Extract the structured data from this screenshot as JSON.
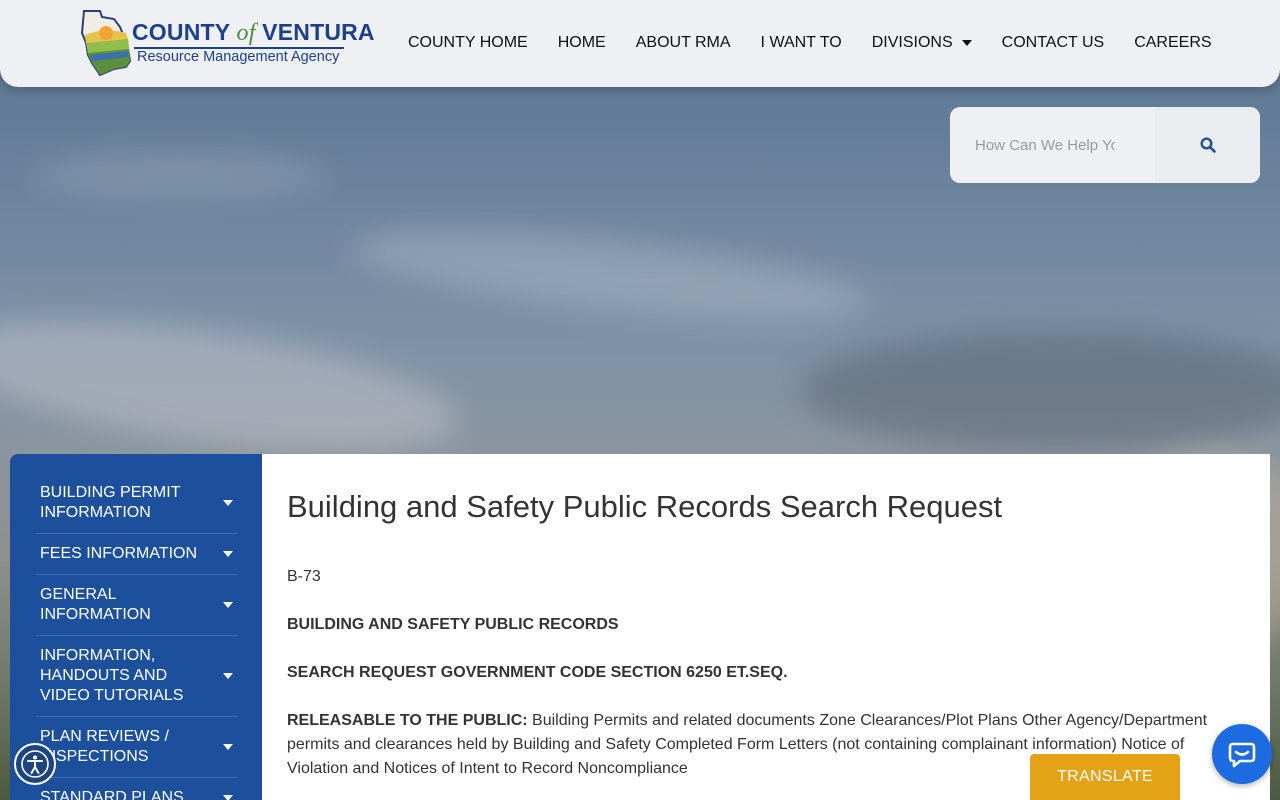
{
  "header": {
    "logo": {
      "line1_a": "COUNTY",
      "line1_of": "of",
      "line1_b": "VENTURA",
      "line2": "Resource Management Agency"
    },
    "nav": [
      {
        "label": "COUNTY HOME"
      },
      {
        "label": "HOME"
      },
      {
        "label": "ABOUT RMA"
      },
      {
        "label": "I WANT TO"
      },
      {
        "label": "DIVISIONS",
        "icon": "chevron-down-icon"
      },
      {
        "label": "CONTACT US"
      },
      {
        "label": "CAREERS"
      }
    ]
  },
  "search": {
    "placeholder": "How Can We Help You?",
    "icon": "search-icon"
  },
  "sidebar": {
    "items": [
      {
        "label": "BUILDING PERMIT INFORMATION"
      },
      {
        "label": "FEES INFORMATION"
      },
      {
        "label": "GENERAL INFORMATION"
      },
      {
        "label": "INFORMATION, HANDOUTS AND VIDEO TUTORIALS"
      },
      {
        "label": "PLAN REVIEWS / INSPECTIONS"
      },
      {
        "label": "STANDARD PLANS"
      }
    ]
  },
  "content": {
    "title": "Building and Safety Public Records Search Request",
    "code": "B-73",
    "heading1": "BUILDING AND SAFETY PUBLIC RECORDS",
    "heading2": "SEARCH REQUEST GOVERNMENT CODE SECTION 6250 ET.SEQ.",
    "releasable_label": "RELEASABLE TO THE PUBLIC:",
    "releasable_text": " Building Permits and related documents Zone Clearances/Plot Plans Other Agency/Department permits and clearances held by Building and Safety Completed Form Letters (not containing complainant information) Notice of Violation and Notices of Intent to Record Noncompliance"
  },
  "floating": {
    "translate_label": "TRANSLATE",
    "accessibility_icon": "accessibility-icon",
    "chat_icon": "chat-icon"
  },
  "colors": {
    "sidebar_bg": "#1c4f9c",
    "translate_bg": "#e4a316",
    "chat_bg": "#1c6be0",
    "brand_blue": "#1d3f8f"
  }
}
